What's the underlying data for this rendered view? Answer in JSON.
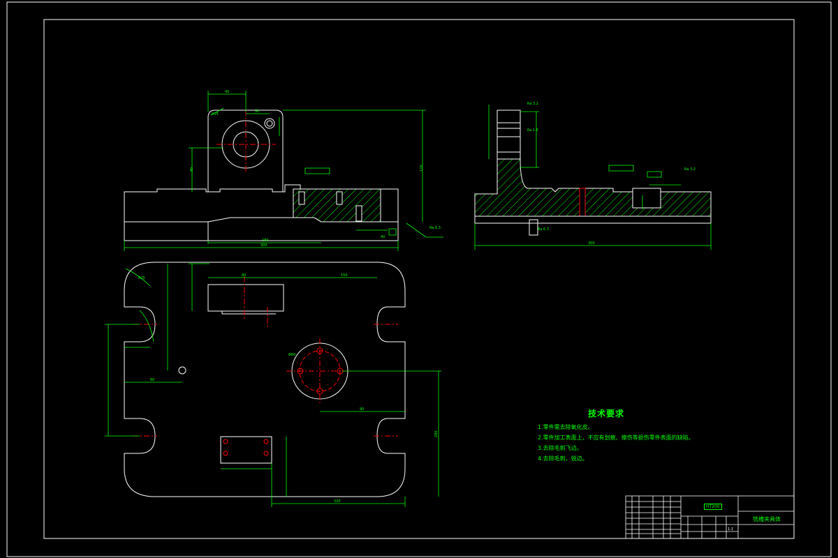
{
  "notes": {
    "title": "技术要求",
    "items": [
      "1.零件需去除氧化皮。",
      "2.零件加工表面上，不应有划痕、擦伤等损伤零件表面的缺陷。",
      "3.去除毛刺飞边。",
      "4.去除毛刺，锐边。"
    ]
  },
  "title_block": {
    "drawing_name": "铣槽夹具体",
    "material": "HT200",
    "scale": "1:1"
  },
  "dimensions": {
    "front_top": "40",
    "front_r": "R15",
    "front_inner": "50",
    "front_h": "120",
    "front_left_h": "80",
    "front_w1": "180",
    "front_w2": "300",
    "front_right": "40",
    "side_total": "300",
    "plan_r": "R25",
    "plan_top_w": "80",
    "plan_top_w2": "150",
    "plan_h": "280",
    "plan_w": "320",
    "plan_x": "60",
    "plan_x2": "90",
    "plan_pcd": "Φ60"
  },
  "roughness": {
    "r1": "Ra 3.2",
    "r2": "Ra 6.3",
    "r3": "Ra 1.6"
  },
  "colors": {
    "outline": "#ffffff",
    "dimension": "#00ff00",
    "center": "#ff0000",
    "text": "#00ff00"
  }
}
